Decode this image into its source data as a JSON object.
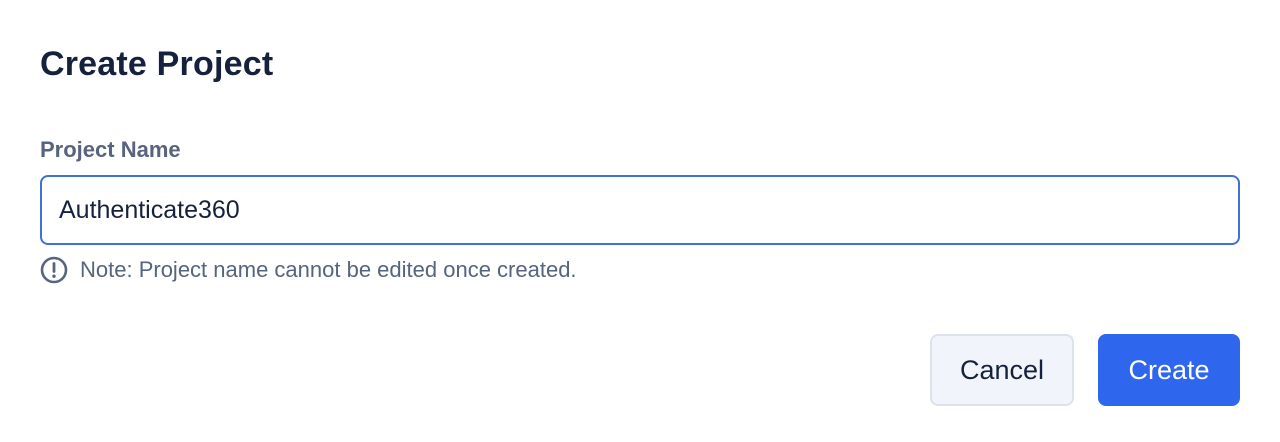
{
  "dialog": {
    "title": "Create Project"
  },
  "form": {
    "project_name_label": "Project Name",
    "project_name_value": "Authenticate360",
    "note_icon": "alert-circle-icon",
    "note_text": "Note: Project name cannot be edited once created."
  },
  "actions": {
    "cancel_label": "Cancel",
    "create_label": "Create"
  },
  "colors": {
    "primary": "#2e67ee",
    "input_border": "#3f72d6",
    "label_text": "#56647e",
    "title_text": "#16213d"
  }
}
